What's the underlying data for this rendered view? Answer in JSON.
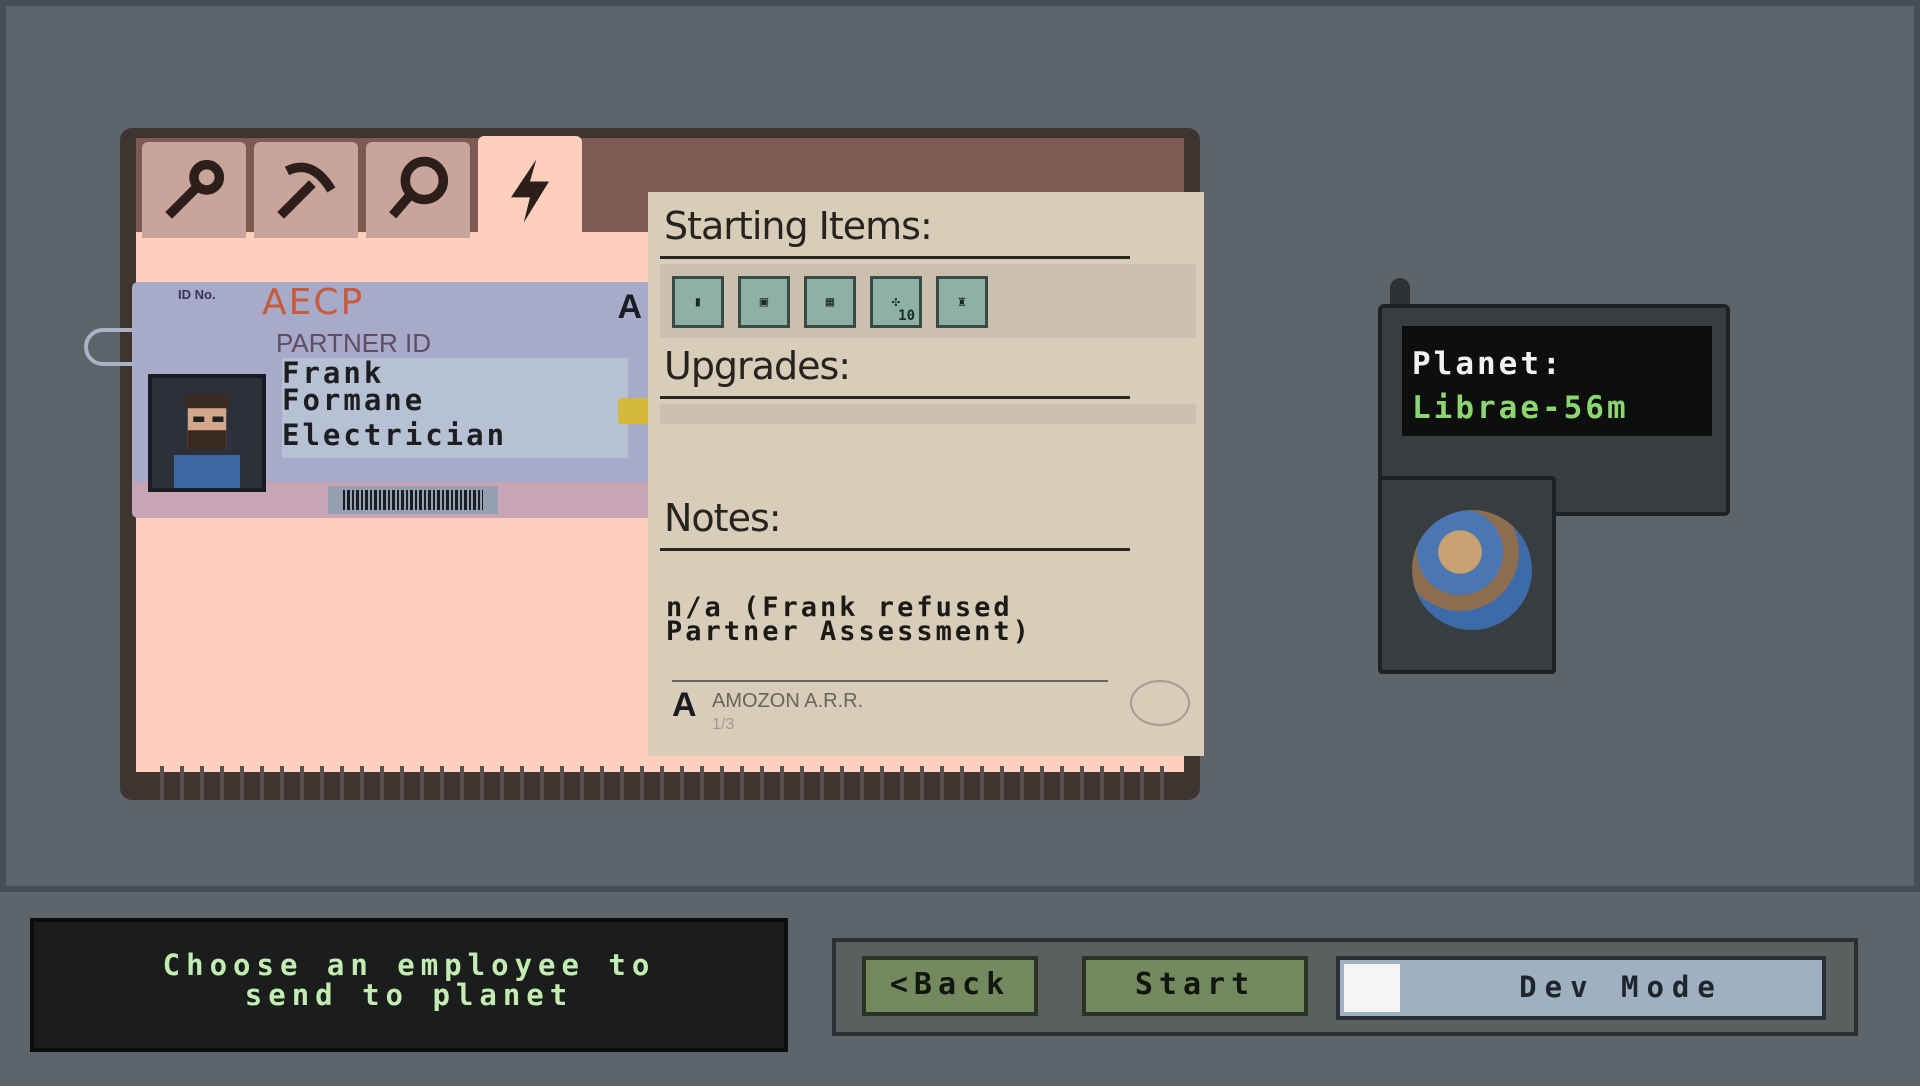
{
  "tabs": [
    {
      "name": "wrench-icon"
    },
    {
      "name": "pickaxe-icon"
    },
    {
      "name": "magnifier-icon"
    },
    {
      "name": "lightning-icon",
      "active": true
    }
  ],
  "id_card": {
    "brand": "AECP",
    "id_label": "ID No.",
    "partner_id": "PARTNER ID",
    "first_name": "Frank",
    "last_name": "Formane",
    "role": "Electrician"
  },
  "sheet": {
    "starting_items_label": "Starting Items:",
    "items": [
      {
        "icon": "battery-icon",
        "count": ""
      },
      {
        "icon": "device-icon",
        "count": ""
      },
      {
        "icon": "solar-panel-icon",
        "count": ""
      },
      {
        "icon": "plant-icon",
        "count": "10"
      },
      {
        "icon": "robot-icon",
        "count": ""
      }
    ],
    "upgrades_label": "Upgrades:",
    "notes_label": "Notes:",
    "notes_line1": "n/a (Frank refused",
    "notes_line2": "Partner Assessment)",
    "footer_company": "AMOZON A.R.R.",
    "footer_page": "1/3"
  },
  "device": {
    "label": "Planet:",
    "value": "Librae-56m"
  },
  "bottom": {
    "message_line1": "Choose an employee to",
    "message_line2": "send to planet",
    "back_label": "<Back",
    "start_label": "Start",
    "devmode_label": "Dev Mode"
  }
}
